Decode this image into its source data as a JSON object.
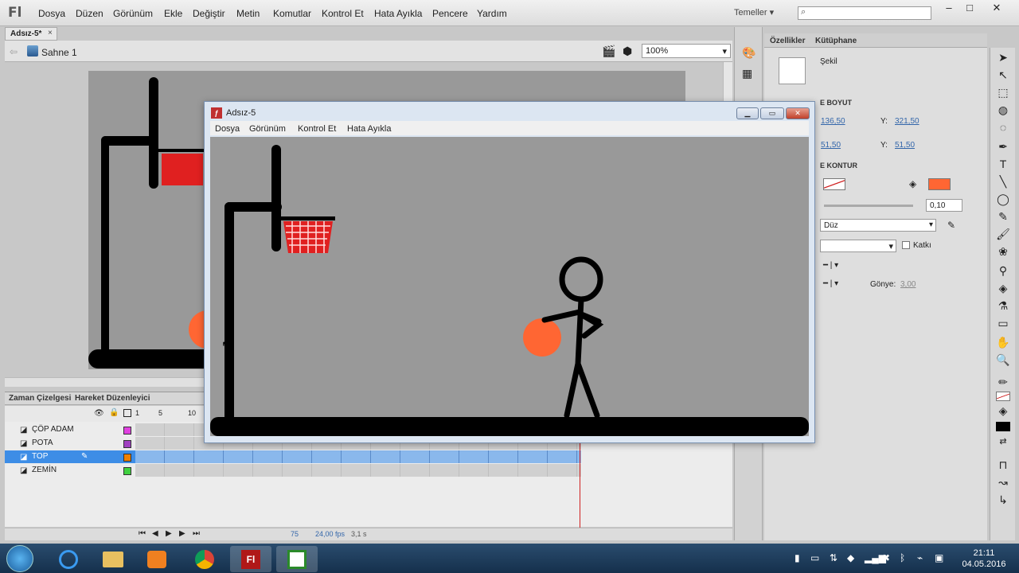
{
  "menubar": {
    "logo": "Fl",
    "items": [
      "Dosya",
      "Düzen",
      "Görünüm",
      "Ekle",
      "Değiştir",
      "Metin",
      "Komutlar",
      "Kontrol Et",
      "Hata Ayıkla",
      "Pencere",
      "Yardım"
    ],
    "workspace": "Temeller",
    "window_buttons": [
      "–",
      "□",
      "✕"
    ]
  },
  "document": {
    "tab": "Adsız-5*",
    "tab_close": "×",
    "scene": "Sahne 1",
    "zoom": "100%"
  },
  "timeline": {
    "tabs": [
      "Zaman Çizelgesi",
      "Hareket Düzenleyici"
    ],
    "ruler": [
      "1",
      "5",
      "10"
    ],
    "layers": [
      {
        "name": "ÇÖP ADAM",
        "color": "#e040e0",
        "selected": false
      },
      {
        "name": "POTA",
        "color": "#a040c0",
        "selected": false
      },
      {
        "name": "TOP",
        "color": "#f08000",
        "selected": true
      },
      {
        "name": "ZEMİN",
        "color": "#40d040",
        "selected": false
      }
    ],
    "current_frame": "75",
    "fps": "24,00 fps",
    "time": "3,1 s"
  },
  "properties": {
    "tabs": [
      "Özellikler",
      "Kütüphane"
    ],
    "object_type": "Şekil",
    "position_section": "E BOYUT",
    "x": "136,50",
    "y": "321,50",
    "w": "51,50",
    "h": "51,50",
    "x_label": "Y:",
    "y_label": "Y:",
    "fill_section": "E KONTUR",
    "stroke_width": "0,10",
    "style": "Düz",
    "hinting_label": "Katkı",
    "miter_label": "Gönye:",
    "miter_value": "3,00",
    "fill_color": "#ff6633"
  },
  "player": {
    "title": "Adsız-5",
    "menu": [
      "Dosya",
      "Görünüm",
      "Kontrol Et",
      "Hata Ayıkla"
    ]
  },
  "taskbar": {
    "time": "21:11",
    "date": "04.05.2016"
  }
}
